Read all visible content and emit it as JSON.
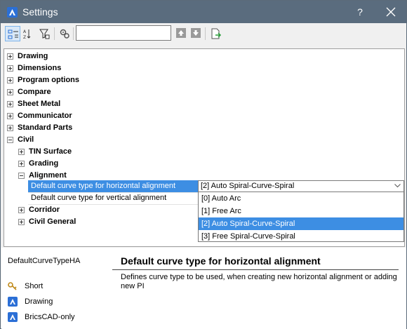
{
  "window": {
    "title": "Settings",
    "help_label": "?"
  },
  "toolbar": {
    "search_value": "",
    "search_placeholder": ""
  },
  "tree": {
    "top_items": [
      {
        "label": "Drawing",
        "expanded": false
      },
      {
        "label": "Dimensions",
        "expanded": false
      },
      {
        "label": "Program options",
        "expanded": false
      },
      {
        "label": "Compare",
        "expanded": false
      },
      {
        "label": "Sheet Metal",
        "expanded": false
      },
      {
        "label": "Communicator",
        "expanded": false
      },
      {
        "label": "Standard Parts",
        "expanded": false
      },
      {
        "label": "Civil",
        "expanded": true
      }
    ],
    "civil_children": [
      {
        "label": "TIN Surface",
        "expanded": false
      },
      {
        "label": "Grading",
        "expanded": false
      },
      {
        "label": "Alignment",
        "expanded": true
      }
    ],
    "alignment_props": [
      {
        "label": "Default curve type for horizontal alignment",
        "selected": true
      },
      {
        "label": "Default curve type for vertical alignment",
        "selected": false
      }
    ],
    "civil_children_after": [
      {
        "label": "Corridor",
        "expanded": false
      },
      {
        "label": "Civil General",
        "expanded": false
      }
    ]
  },
  "combo": {
    "value": "[2] Auto Spiral-Curve-Spiral",
    "options": [
      "[0] Auto Arc",
      "[1] Free Arc",
      "[2] Auto Spiral-Curve-Spiral",
      "[3] Free Spiral-Curve-Spiral"
    ],
    "highlighted_index": 2
  },
  "info": {
    "variable_name": "DefaultCurveTypeHA",
    "title": "Default curve type for horizontal alignment",
    "description": "Defines curve type to be used, when creating new horizontal alignment or adding new PI",
    "attributes": [
      {
        "label": "Short",
        "icon": "key-icon"
      },
      {
        "label": "Drawing",
        "icon": "bricscad-icon"
      },
      {
        "label": "BricsCAD-only",
        "icon": "bricscad-icon"
      }
    ]
  },
  "colors": {
    "titlebar": "#5a6c7e",
    "selection": "#3d8ee3",
    "app_icon": "#2b6fd6"
  }
}
